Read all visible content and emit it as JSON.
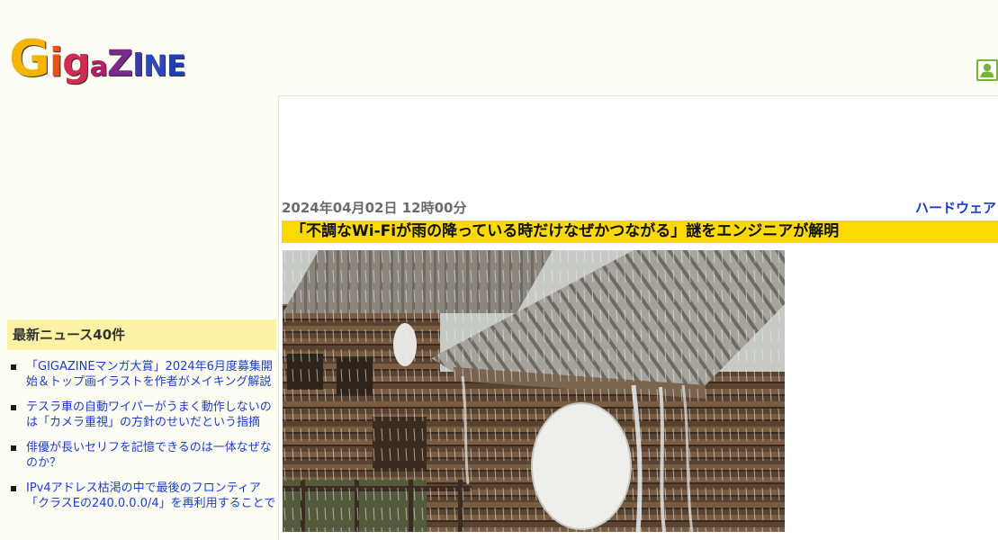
{
  "header": {
    "logo_letters": [
      "G",
      "i",
      "g",
      "a",
      "Z",
      "I",
      "N",
      "E"
    ],
    "user_icon": "user-icon"
  },
  "article": {
    "date": "2024年04月02日 12時00分",
    "category": "ハードウェア",
    "title": "「不調なWi-Fiが雨の降っている時だけなぜかつながる」謎をエンジニアが解明",
    "image": "rain-falling-on-wooden-cabins-with-satellite-dishes"
  },
  "sidebar": {
    "heading": "最新ニュース40件",
    "items": [
      {
        "label": "「GIGAZINEマンガ大賞」2024年6月度募集開始＆トップ画イラストを作者がメイキング解説"
      },
      {
        "label": "テスラ車の自動ワイパーがうまく動作しないのは「カメラ重視」の方針のせいだという指摘"
      },
      {
        "label": "俳優が長いセリフを記憶できるのは一体なぜなのか？"
      },
      {
        "label": "IPv4アドレス枯渇の中で最後のフロンティア「クラスEの240.0.0.0/4」を再利用することで"
      }
    ]
  },
  "colors": {
    "background": "#fdfdf3",
    "title_bar": "#fcd900",
    "link": "#1a3bd1",
    "news_heading_bg": "#fbf3a3",
    "user_button": "#79b33e"
  }
}
